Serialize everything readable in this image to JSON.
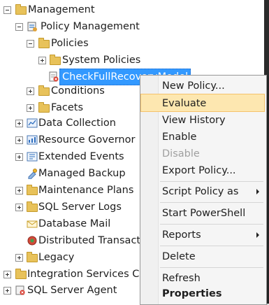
{
  "tree": {
    "management": "Management",
    "policy_management": "Policy Management",
    "policies": "Policies",
    "system_policies": "System Policies",
    "check_full_recovery": "CheckFullRecoveryModel",
    "conditions": "Conditions",
    "facets": "Facets",
    "data_collection": "Data Collection",
    "resource_governor": "Resource Governor",
    "extended_events": "Extended Events",
    "managed_backup": "Managed Backup",
    "maintenance_plans": "Maintenance Plans",
    "sql_server_logs": "SQL Server Logs",
    "database_mail": "Database Mail",
    "distributed_transaction": "Distributed Transaction",
    "legacy": "Legacy",
    "integration_services": "Integration Services Cata",
    "sql_server_agent": "SQL Server Agent"
  },
  "context_menu": {
    "new_policy": "New Policy...",
    "evaluate": "Evaluate",
    "view_history": "View History",
    "enable": "Enable",
    "disable": "Disable",
    "export_policy": "Export Policy...",
    "script_policy_as": "Script Policy as",
    "start_powershell": "Start PowerShell",
    "reports": "Reports",
    "delete": "Delete",
    "refresh": "Refresh",
    "properties": "Properties"
  },
  "colors": {
    "selection": "#3399ff",
    "menu_hover": "#fde7b0",
    "folder": "#e8c25a"
  }
}
